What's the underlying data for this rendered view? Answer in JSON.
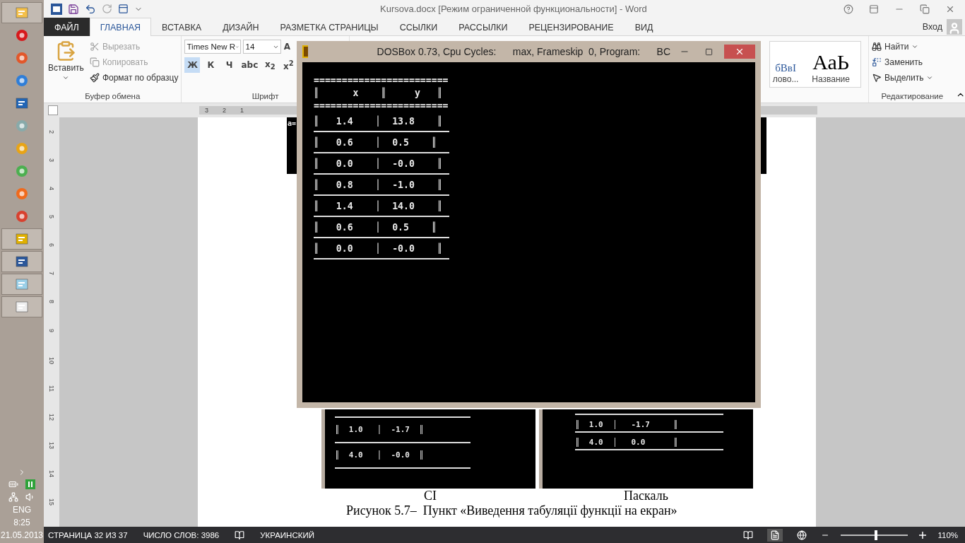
{
  "taskbar": {
    "apps": [
      {
        "kind": "folder",
        "running": true
      },
      {
        "kind": "opera",
        "running": false
      },
      {
        "kind": "bird",
        "running": false
      },
      {
        "kind": "bolt",
        "running": false
      },
      {
        "kind": "player",
        "running": false
      },
      {
        "kind": "robot",
        "running": false
      },
      {
        "kind": "yellow",
        "running": false
      },
      {
        "kind": "chrome",
        "running": false
      },
      {
        "kind": "orange",
        "running": false
      },
      {
        "kind": "red",
        "running": false
      },
      {
        "kind": "dosbox",
        "running": true
      },
      {
        "kind": "word",
        "running": true
      },
      {
        "kind": "notepad",
        "running": true
      },
      {
        "kind": "app",
        "running": true
      }
    ],
    "tray": {
      "language": "ENG",
      "time": "8:25",
      "date": "21.05.2013"
    }
  },
  "word": {
    "title": "Kursova.docx [Режим ограниченной функциональности] - Word",
    "sign_in": "Вход",
    "tabs": [
      {
        "label": "ФАЙЛ",
        "kind": "file",
        "selected": false
      },
      {
        "label": "ГЛАВНАЯ",
        "kind": "tab",
        "selected": true
      },
      {
        "label": "ВСТАВКА",
        "kind": "tab",
        "selected": false
      },
      {
        "label": "ДИЗАЙН",
        "kind": "tab",
        "selected": false
      },
      {
        "label": "РАЗМЕТКА СТРАНИЦЫ",
        "kind": "tab",
        "selected": false
      },
      {
        "label": "ССЫЛКИ",
        "kind": "tab",
        "selected": false
      },
      {
        "label": "РАССЫЛКИ",
        "kind": "tab",
        "selected": false
      },
      {
        "label": "РЕЦЕНЗИРОВАНИЕ",
        "kind": "tab",
        "selected": false
      },
      {
        "label": "ВИД",
        "kind": "tab",
        "selected": false
      }
    ],
    "clipboard": {
      "paste": "Вставить",
      "cut": {
        "label": "Вырезать",
        "disabled": true
      },
      "copy": {
        "label": "Копировать",
        "disabled": true
      },
      "format_painter": {
        "label": "Формат по образцу",
        "disabled": false
      },
      "group": "Буфер обмена"
    },
    "font": {
      "name": "Times New R",
      "size": "14",
      "grow": "A",
      "group": "Шрифт",
      "buttons": [
        {
          "label": "Ж",
          "selected": true
        },
        {
          "label": "К",
          "selected": false
        },
        {
          "label": "Ч",
          "selected": false
        },
        {
          "label": "abc",
          "selected": false
        },
        {
          "label": "x$_{2}$",
          "selected": false
        },
        {
          "label": "x$^{2}$",
          "selected": false
        }
      ]
    },
    "styles": [
      {
        "preview": "бВвІ",
        "name": "лово..."
      },
      {
        "preview": "АаЬ",
        "name": "Название"
      }
    ],
    "editing": {
      "find": "Найти",
      "replace": "Заменить",
      "select": "Выделить",
      "group": "Редактирование"
    },
    "ruler": {
      "horizontal": [
        "3",
        "2",
        "1"
      ],
      "vertical": [
        "2",
        "3",
        "4",
        "5",
        "6",
        "7",
        "8",
        "9",
        "10",
        "11",
        "12",
        "13",
        "14",
        "15"
      ]
    },
    "document": {
      "top_image_text": "a=",
      "figures": [
        {
          "caption": "CI",
          "rows": [
            "║  1.0   │  -1.7  ║",
            "║  4.0   │  -0.0  ║"
          ]
        },
        {
          "caption": "Паскаль",
          "rows": [
            "║  1.0  │   -1.7     ║",
            "║  4.0  │   0.0      ║"
          ]
        }
      ],
      "figure_caption": "Рисунок 5.7–  Пункт «Виведення табуляції функції на екран»"
    },
    "status_bar": {
      "page": "СТРАНИЦА 32 ИЗ 37",
      "words": "ЧИСЛО СЛОВ: 3986",
      "language": "УКРАИНСКИЙ",
      "views": [
        {
          "kind": "read",
          "selected": false
        },
        {
          "kind": "print",
          "selected": true
        },
        {
          "kind": "web",
          "selected": false
        }
      ],
      "zoom": {
        "level": 0.52,
        "reading": "110%"
      }
    }
  },
  "dosbox": {
    "title": "DOSBox 0.73, Cpu Cycles:      max, Frameskip  0, Program:      BC",
    "rule": "========================",
    "header": "║      x    ║     y   ║",
    "rows": [
      "║   1.4    │  13.8    ║",
      "║   0.6    │  0.5    ║",
      "║   0.0    │  -0.0    ║",
      "║   0.8    │  -1.0    ║",
      "║   1.4    │  14.0    ║",
      "║   0.6    │  0.5    ║",
      "║   0.0    │  -0.0    ║"
    ]
  }
}
